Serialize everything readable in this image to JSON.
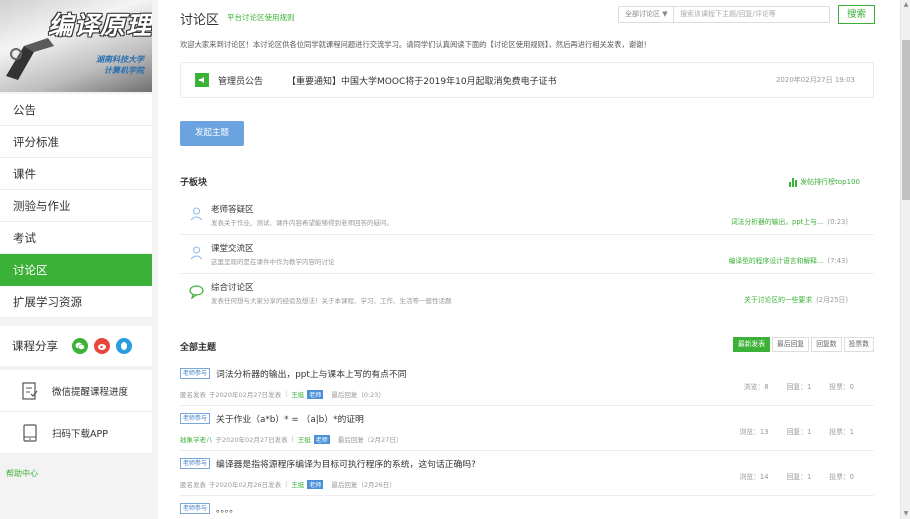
{
  "course": {
    "title": "编译原理",
    "subtitle_lines": [
      "湖南科技大学",
      "计算机学院"
    ]
  },
  "sidebar": {
    "items": [
      {
        "label": "公告"
      },
      {
        "label": "评分标准"
      },
      {
        "label": "课件"
      },
      {
        "label": "测验与作业"
      },
      {
        "label": "考试"
      },
      {
        "label": "讨论区",
        "active": true
      },
      {
        "label": "扩展学习资源"
      }
    ],
    "share_label": "课程分享",
    "share_icons": [
      "wechat-icon",
      "weibo-icon",
      "qq-icon"
    ],
    "tools": [
      {
        "label": "微信提醒课程进度",
        "icon": "reminder-icon"
      },
      {
        "label": "扫码下载APP",
        "icon": "phone-icon"
      }
    ],
    "help": "帮助中心"
  },
  "header": {
    "title": "讨论区",
    "rules_link": "平台讨论区使用规则",
    "filter": "全部讨论区 ▼",
    "search_placeholder": "搜索该课程下主题/回复/评论等",
    "search_button": "搜索"
  },
  "welcome": "欢迎大家来到讨论区！本讨论区供各位同学就课程问题进行交流学习。请同学们认真阅读下面的【讨论区使用规则】，然后再进行相关发表，谢谢！",
  "notice": {
    "tag": "管理员公告",
    "text": "【重要通知】中国大学MOOC将于2019年10月起取消免费电子证书",
    "time": "2020年02月27日 19:03"
  },
  "post_button": "发起主题",
  "boards": {
    "title": "子板块",
    "rank_link": "发帖排行榜top100",
    "items": [
      {
        "name": "老师答疑区",
        "desc": "发表关于作业、测试、课件内容希望能够得到老师回答的疑问。",
        "latest": "词法分析器的输出，ppt上与...",
        "time": "(0:23)",
        "icon": "person-icon"
      },
      {
        "name": "课堂交流区",
        "desc": "这里呈现的是在课件中作为教学内容的讨论",
        "latest": "编译型的程序设计语言和解释...",
        "time": "(7:43)",
        "icon": "person-icon"
      },
      {
        "name": "综合讨论区",
        "desc": "发表任何想与大家分享的经验及想法！关于本课程、学习、工作、生活等一般性话题",
        "latest": "关于讨论区的一些要求",
        "time": "(2月25日)",
        "icon": "chat-bubble-icon"
      }
    ]
  },
  "topics": {
    "title": "全部主题",
    "sort_tabs": [
      "最新发表",
      "最后回复",
      "回复数",
      "投票数"
    ],
    "items": [
      {
        "badge": "老师参与",
        "title": "词法分析器的输出，ppt上与课本上写的有点不同",
        "author": "匿名发表",
        "author_green": false,
        "posted": "于2020年02月27日发表",
        "replier": "王挺",
        "role": "老师",
        "last_reply": "最后回复（0:23）",
        "views": "浏览：8",
        "replies": "回复：1",
        "votes": "投票：0"
      },
      {
        "badge": "老师参与",
        "title": "关于作业（a*b）* = （a|b）*的证明",
        "author": "拙象学老八",
        "author_green": true,
        "posted": "于2020年02月27日发表",
        "replier": "王挺",
        "role": "老师",
        "last_reply": "最后回复（2月27日）",
        "views": "浏览：13",
        "replies": "回复：1",
        "votes": "投票：1"
      },
      {
        "badge": "老师参与",
        "title": "编译器是指将源程序编译为目标可执行程序的系统，这句话正确吗?",
        "author": "匿名发表",
        "author_green": false,
        "posted": "于2020年02月26日发表",
        "replier": "王挺",
        "role": "老师",
        "last_reply": "最后回复（2月26日）",
        "views": "浏览：14",
        "replies": "回复：1",
        "votes": "投票：0"
      },
      {
        "badge": "老师参与",
        "title": "。。。。",
        "author": "",
        "author_green": false,
        "posted": "",
        "replier": "",
        "role": "",
        "last_reply": "",
        "views": "",
        "replies": "",
        "votes": ""
      }
    ]
  },
  "colors": {
    "accent": "#3bb137",
    "button_blue": "#6aa3e0",
    "badge_blue": "#3a78c2"
  }
}
